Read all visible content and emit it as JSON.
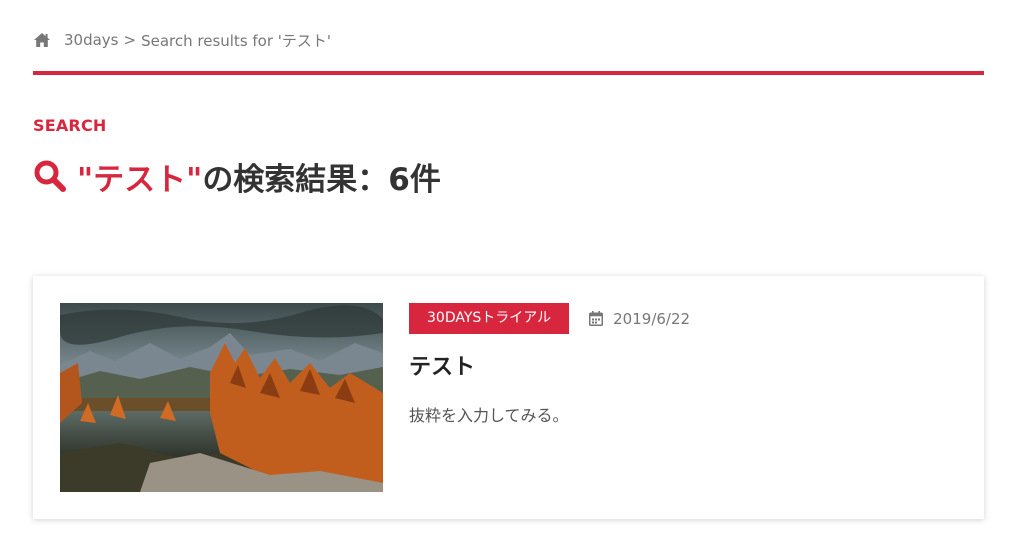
{
  "breadcrumb": {
    "home_icon": "home-icon",
    "site": "30days",
    "separator": ">",
    "current": "Search results for 'テスト'"
  },
  "colors": {
    "accent": "#d7263d",
    "text": "#333333",
    "muted": "#777777"
  },
  "section": {
    "label": "SEARCH"
  },
  "heading": {
    "icon": "search-icon",
    "query": "\"テスト\"",
    "suffix": "の検索結果：6件"
  },
  "results": [
    {
      "thumbnail_alt": "autumn mountain lake landscape",
      "category": "30DAYSトライアル",
      "date_icon": "calendar-icon",
      "date": "2019/6/22",
      "title": "テスト",
      "excerpt": "抜粋を入力してみる。"
    }
  ]
}
